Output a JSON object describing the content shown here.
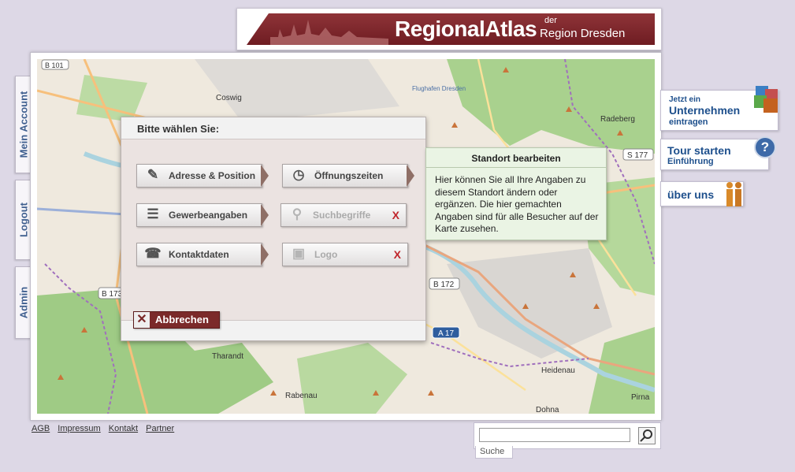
{
  "header": {
    "title": "RegionalAtlas",
    "der": "der",
    "region": "Region Dresden"
  },
  "left_tabs": [
    {
      "label": "Mein Account"
    },
    {
      "label": "Logout"
    },
    {
      "label": "Admin"
    }
  ],
  "right_widgets": {
    "company": {
      "small": "Jetzt ein",
      "big": "Unternehmen",
      "sub": "eintragen"
    },
    "tour": {
      "title": "Tour starten",
      "sub": "Einführung"
    },
    "about": {
      "title": "über uns"
    }
  },
  "map": {
    "places": [
      "Coswig",
      "Radeberg",
      "Tharandt",
      "Rabenau",
      "Heidenau",
      "Dohna",
      "Pirna",
      "Flughafen Dresden"
    ],
    "roads": [
      "B 101",
      "S 177",
      "B 172",
      "B 173",
      "A 17"
    ]
  },
  "dialog": {
    "title": "Bitte wählen Sie:",
    "buttons": [
      {
        "label": "Adresse & Position",
        "disabled": false
      },
      {
        "label": "Öffnungszeiten",
        "disabled": false
      },
      {
        "label": "Gewerbeangaben",
        "disabled": false
      },
      {
        "label": "Suchbegriffe",
        "disabled": true
      },
      {
        "label": "Kontaktdaten",
        "disabled": false
      },
      {
        "label": "Logo",
        "disabled": true
      }
    ],
    "disabled_mark": "X",
    "cancel": "Abbrechen"
  },
  "tooltip": {
    "title": "Standort bearbeiten",
    "body": "Hier können Sie all Ihre Angaben zu diesem Standort ändern oder ergänzen. Die hier gemachten Angaben sind für alle Besucher auf der Karte zusehen."
  },
  "footer": {
    "links": [
      "AGB",
      "Impressum",
      "Kontakt",
      "Partner"
    ]
  },
  "search": {
    "value": "",
    "label": "Suche"
  },
  "colors": {
    "brand": "#7b2a2a",
    "accent": "#1d4f8c",
    "tooltip_bg": "#eaf4e4"
  }
}
